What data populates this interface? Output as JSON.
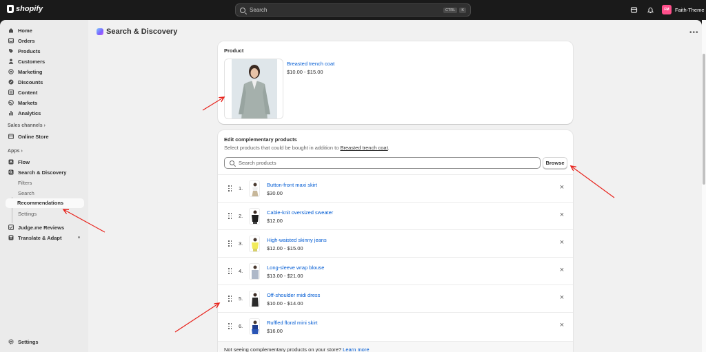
{
  "topbar": {
    "brand": "shopify",
    "search_placeholder": "Search",
    "kbd_ctrl": "CTRL",
    "kbd_k": "K",
    "store_initials": "FM",
    "store_name": "Faith-Theme"
  },
  "sidebar": {
    "items": [
      {
        "label": "Home",
        "icon": "home-icon"
      },
      {
        "label": "Orders",
        "icon": "orders-icon"
      },
      {
        "label": "Products",
        "icon": "tag-icon"
      },
      {
        "label": "Customers",
        "icon": "person-icon"
      },
      {
        "label": "Marketing",
        "icon": "target-icon"
      },
      {
        "label": "Discounts",
        "icon": "discount-icon"
      },
      {
        "label": "Content",
        "icon": "content-icon"
      },
      {
        "label": "Markets",
        "icon": "globe-icon"
      },
      {
        "label": "Analytics",
        "icon": "chart-icon"
      }
    ],
    "sales_channels_heading": "Sales channels",
    "online_store": "Online Store",
    "apps_heading": "Apps",
    "flow": "Flow",
    "search_discovery": "Search & Discovery",
    "sub_filters": "Filters",
    "sub_search": "Search",
    "sub_recommendations": "Recommendations",
    "sub_settings": "Settings",
    "judgeme": "Judge.me Reviews",
    "translate": "Translate & Adapt",
    "settings": "Settings"
  },
  "main": {
    "page_title": "Search & Discovery",
    "product_card": {
      "title": "Product",
      "product_name": "Breasted trench coat",
      "price": "$10.00 - $15.00"
    },
    "complementary": {
      "title": "Edit complementary products",
      "desc_prefix": "Select products that could be bought in addition to ",
      "desc_link": "Breasted trench coat",
      "desc_suffix": ".",
      "search_placeholder": "Search products",
      "browse": "Browse",
      "rows": [
        {
          "num": "1.",
          "name": "Button-front maxi skirt",
          "price": "$30.00"
        },
        {
          "num": "2.",
          "name": "Cable-knit oversized sweater",
          "price": "$12.00"
        },
        {
          "num": "3.",
          "name": "High-waisted skinny jeans",
          "price": "$12.00 - $15.00"
        },
        {
          "num": "4.",
          "name": "Long-sleeve wrap blouse",
          "price": "$13.00 - $21.00"
        },
        {
          "num": "5.",
          "name": "Off-shoulder midi dress",
          "price": "$10.00 - $14.00"
        },
        {
          "num": "6.",
          "name": "Ruffled floral mini skirt",
          "price": "$16.00"
        }
      ],
      "footer_text": "Not seeing complementary products on your store? ",
      "footer_link": "Learn more"
    }
  },
  "colors": {
    "link": "#005bd3",
    "annotation_arrow": "#e8221b",
    "store_avatar": "#ff4f8b"
  }
}
